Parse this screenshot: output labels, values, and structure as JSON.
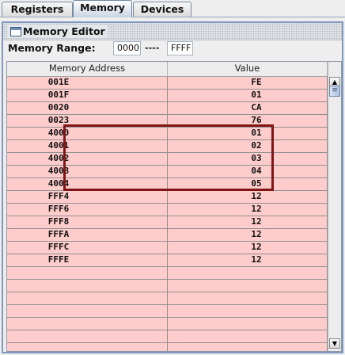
{
  "tabs": [
    {
      "label": "Registers",
      "active": false
    },
    {
      "label": "Memory",
      "active": true
    },
    {
      "label": "Devices",
      "active": false
    }
  ],
  "frame": {
    "title": "Memory Editor",
    "icon": "window-icon"
  },
  "range": {
    "label": "Memory Range:",
    "start": "0000",
    "separator": "----",
    "end": "FFFF"
  },
  "table": {
    "columns": [
      "Memory Address",
      "Value"
    ],
    "rows": [
      {
        "address": "001E",
        "value": "FE"
      },
      {
        "address": "001F",
        "value": "01"
      },
      {
        "address": "0020",
        "value": "CA"
      },
      {
        "address": "0023",
        "value": "76"
      },
      {
        "address": "4000",
        "value": "01"
      },
      {
        "address": "4001",
        "value": "02"
      },
      {
        "address": "4002",
        "value": "03"
      },
      {
        "address": "4003",
        "value": "04"
      },
      {
        "address": "4004",
        "value": "05"
      },
      {
        "address": "FFF4",
        "value": "12"
      },
      {
        "address": "FFF6",
        "value": "12"
      },
      {
        "address": "FFF8",
        "value": "12"
      },
      {
        "address": "FFFA",
        "value": "12"
      },
      {
        "address": "FFFC",
        "value": "12"
      },
      {
        "address": "FFFE",
        "value": "12"
      },
      {
        "address": "",
        "value": ""
      },
      {
        "address": "",
        "value": ""
      },
      {
        "address": "",
        "value": ""
      },
      {
        "address": "",
        "value": ""
      },
      {
        "address": "",
        "value": ""
      },
      {
        "address": "",
        "value": ""
      },
      {
        "address": "",
        "value": ""
      }
    ]
  },
  "scrollbar": {
    "up_icon": "▲",
    "down_icon": "▼",
    "thumb_grip": "≡"
  },
  "colors": {
    "row_bg": "#ffcccc",
    "highlight_border": "#801515",
    "frame_border": "#7f98c0"
  }
}
